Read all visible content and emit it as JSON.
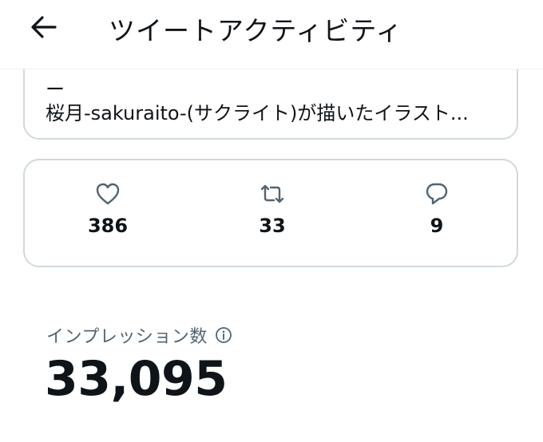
{
  "header": {
    "title": "ツイートアクティビティ",
    "back_icon": "arrow-left-icon"
  },
  "tweet": {
    "line1": "ー",
    "line2": "桜月-sakuraito-(サクライト)が描いたイラスト..."
  },
  "stats": {
    "likes": {
      "icon": "heart-icon",
      "count": "386"
    },
    "retweets": {
      "icon": "retweet-icon",
      "count": "33"
    },
    "replies": {
      "icon": "reply-bubble-icon",
      "count": "9"
    }
  },
  "impressions": {
    "label": "インプレッション数",
    "value": "33,095",
    "info_icon": "info-icon"
  },
  "colors": {
    "text_primary": "#0f1419",
    "text_secondary": "#536471",
    "border": "#cfd9de"
  }
}
